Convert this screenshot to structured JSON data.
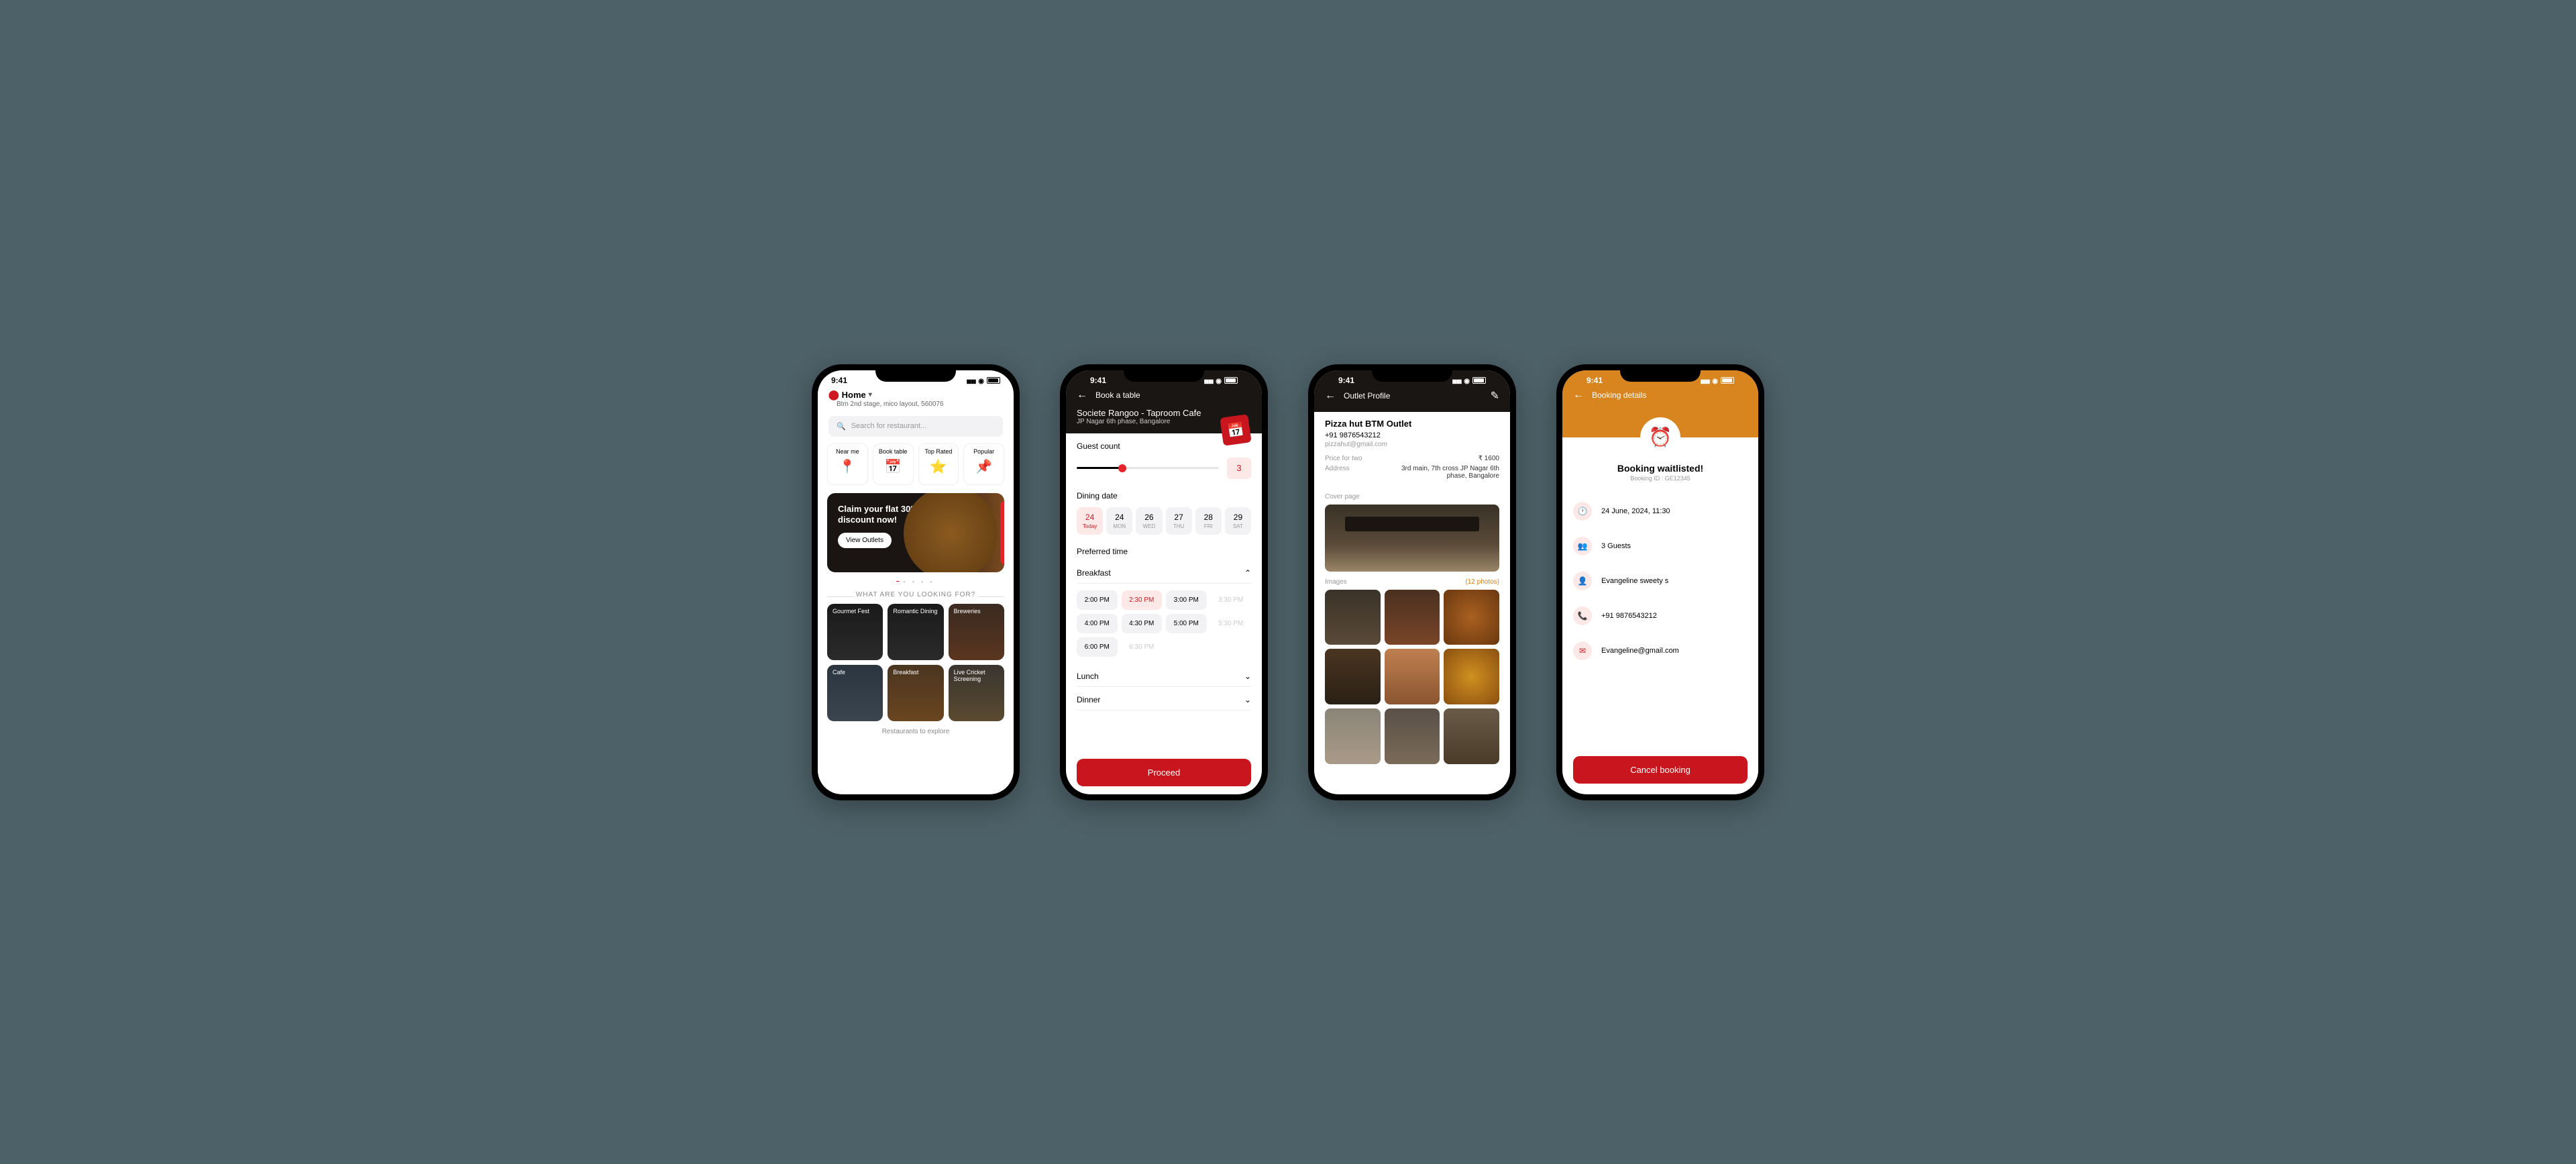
{
  "status": {
    "time": "9:41"
  },
  "home": {
    "location_label": "Home",
    "location_address": "Btm 2nd stage, mico layout, 560076",
    "search_placeholder": "Search for restaurant...",
    "quick": [
      {
        "label": "Near me"
      },
      {
        "label": "Book table"
      },
      {
        "label": "Top Rated"
      },
      {
        "label": "Popular"
      }
    ],
    "promo": {
      "title": "Claim your flat 30% discount now!",
      "cta": "View Outlets"
    },
    "section_title": "WHAT ARE YOU LOOKING FOR?",
    "cats": [
      {
        "label": "Gourmet Fest"
      },
      {
        "label": "Romantic Dining"
      },
      {
        "label": "Breweries"
      },
      {
        "label": "Cafe"
      },
      {
        "label": "Breakfast"
      },
      {
        "label": "Live Cricket Screening"
      }
    ],
    "explore": "Restaurants to explore"
  },
  "book": {
    "screen_title": "Book a table",
    "restaurant": "Societe Rangoo - Taproom Cafe",
    "restaurant_sub": "JP Nagar 6th phase, Bangalore",
    "guest_label": "Guest count",
    "guest_val": "3",
    "date_label": "Dining date",
    "dates": [
      {
        "num": "24",
        "day": "Today"
      },
      {
        "num": "24",
        "day": "MON"
      },
      {
        "num": "26",
        "day": "WED"
      },
      {
        "num": "27",
        "day": "THU"
      },
      {
        "num": "28",
        "day": "FRI"
      },
      {
        "num": "29",
        "day": "SAT"
      }
    ],
    "time_label": "Preferred time",
    "meal1": "Breakfast",
    "meal2": "Lunch",
    "meal3": "Dinner",
    "times": [
      {
        "t": "2:00 PM",
        "s": ""
      },
      {
        "t": "2:30 PM",
        "s": "active"
      },
      {
        "t": "3:00 PM",
        "s": ""
      },
      {
        "t": "3:30 PM",
        "s": "disabled"
      },
      {
        "t": "4:00 PM",
        "s": ""
      },
      {
        "t": "4:30 PM",
        "s": ""
      },
      {
        "t": "5:00 PM",
        "s": ""
      },
      {
        "t": "5:30 PM",
        "s": "disabled"
      },
      {
        "t": "6:00 PM",
        "s": ""
      },
      {
        "t": "6:30 PM",
        "s": "disabled"
      }
    ],
    "proceed": "Proceed"
  },
  "outlet": {
    "screen_title": "Outlet Profile",
    "name": "Pizza hut BTM Outlet",
    "phone": "+91 9876543212",
    "email": "pizzahut@gmail.com",
    "price_label": "Price for two",
    "price_val": "₹ 1600",
    "addr_label": "Address",
    "addr_val": "3rd main, 7th cross JP Nagar 6th phase, Bangalore",
    "cover_label": "Cover page",
    "images_label": "Images",
    "images_link": "(12 photos)"
  },
  "booking": {
    "screen_title": "Booking details",
    "status": "Booking waitlisted!",
    "booking_id": "Booking ID : GE12345",
    "datetime": "24 June, 2024, 11:30",
    "guests": "3 Guests",
    "name": "Evangeline sweety s",
    "phone": "+91 9876543212",
    "email": "Evangeline@gmail.com",
    "cancel": "Cancel booking"
  }
}
